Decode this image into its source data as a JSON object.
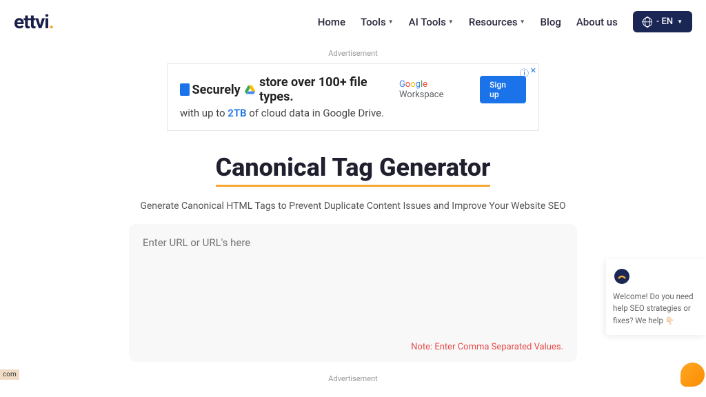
{
  "logo": {
    "text": "ettvi",
    "dot": "."
  },
  "nav": {
    "home": "Home",
    "tools": "Tools",
    "ai_tools": "AI Tools",
    "resources": "Resources",
    "blog": "Blog",
    "about": "About us"
  },
  "lang": {
    "label": "- EN"
  },
  "ad_label_top": "Advertisement",
  "ad_label_bottom": "Advertisement",
  "ad": {
    "headline_pre": "Securely",
    "headline_post": "store over 100+ file types.",
    "subtext_pre": "with up to ",
    "subtext_highlight": "2TB",
    "subtext_post": " of cloud data in Google Drive.",
    "workspace": "Workspace",
    "signup": "Sign up",
    "close": "ⓘ",
    "x": "✕"
  },
  "page": {
    "title": "Canonical Tag Generator",
    "subtitle": "Generate Canonical HTML Tags to Prevent Duplicate Content Issues and Improve Your Website SEO",
    "placeholder": "Enter URL or URL's here",
    "note": "Note: Enter Comma Separated Values."
  },
  "chat": {
    "message": "Welcome! Do you need help SEO strategies or fixes? We help ",
    "emoji": "👇🏻"
  },
  "bottom_link": "com"
}
